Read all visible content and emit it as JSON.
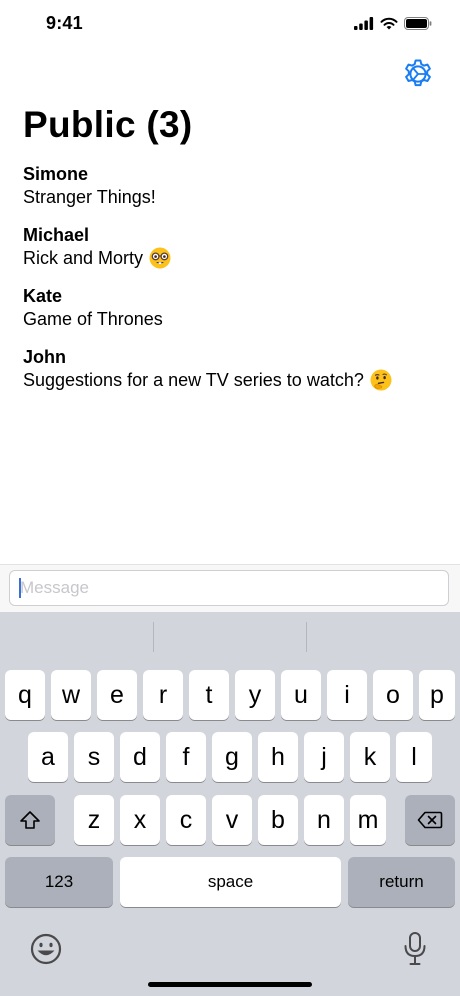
{
  "status": {
    "time": "9:41"
  },
  "header": {
    "title": "Public (3)"
  },
  "messages": [
    {
      "author": "Simone",
      "text": "Stranger Things!",
      "emoji": ""
    },
    {
      "author": "Michael",
      "text": "Rick and Morty",
      "emoji": "nerd-face-emoji"
    },
    {
      "author": "Kate",
      "text": "Game of Thrones",
      "emoji": ""
    },
    {
      "author": "John",
      "text": "Suggestions for a new TV series to watch?",
      "emoji": "thinking-face-emoji"
    }
  ],
  "composer": {
    "placeholder": "Message",
    "value": ""
  },
  "keyboard": {
    "row1": [
      "q",
      "w",
      "e",
      "r",
      "t",
      "y",
      "u",
      "i",
      "o",
      "p"
    ],
    "row2": [
      "a",
      "s",
      "d",
      "f",
      "g",
      "h",
      "j",
      "k",
      "l"
    ],
    "row3": [
      "z",
      "x",
      "c",
      "v",
      "b",
      "n",
      "m"
    ],
    "numbers_label": "123",
    "space_label": "space",
    "return_label": "return"
  },
  "colors": {
    "accent": "#1a7ef2",
    "keyboard_bg": "#d2d5db",
    "dark_key": "#abb0ba"
  }
}
